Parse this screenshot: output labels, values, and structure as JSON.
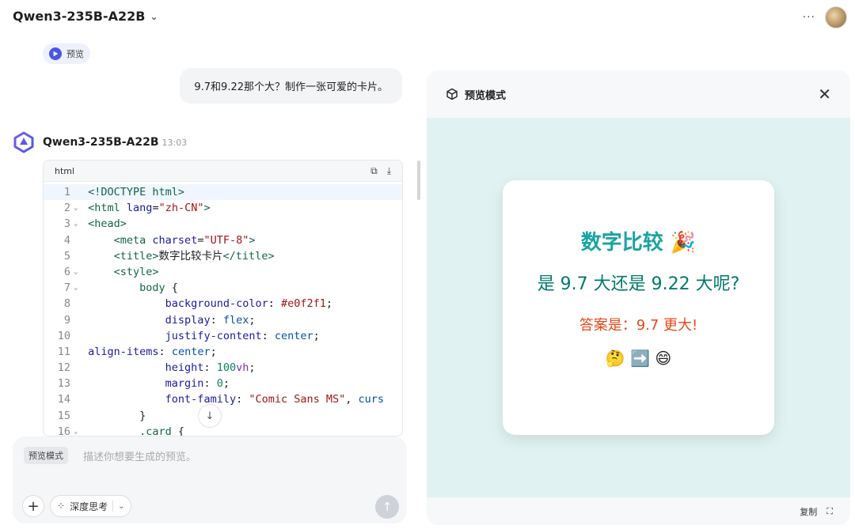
{
  "header": {
    "model_name": "Qwen3-235B-A22B",
    "more_label": "···"
  },
  "preview_pill": {
    "label": "预览"
  },
  "user_message": {
    "text": "9.7和9.22那个大？制作一张可爱的卡片。"
  },
  "assistant": {
    "name": "Qwen3-235B-A22B",
    "time": "13:03"
  },
  "code_block": {
    "lang": "html",
    "lines": [
      {
        "n": "1",
        "fold": "",
        "html": "<span class=\"tg\">&lt;!DOCTYPE html&gt;</span>"
      },
      {
        "n": "2",
        "fold": "⌄",
        "html": "<span class=\"tg\">&lt;html</span> <span class=\"at\">lang</span>=<span class=\"st\">\"zh-CN\"</span><span class=\"tg\">&gt;</span>"
      },
      {
        "n": "3",
        "fold": "⌄",
        "html": "<span class=\"tg\">&lt;head&gt;</span>"
      },
      {
        "n": "4",
        "fold": "",
        "html": "    <span class=\"tg\">&lt;meta</span> <span class=\"at\">charset</span>=<span class=\"st\">\"UTF-8\"</span><span class=\"tg\">&gt;</span>"
      },
      {
        "n": "5",
        "fold": "",
        "html": "    <span class=\"tg\">&lt;title&gt;</span>数字比较卡片<span class=\"tg\">&lt;/title&gt;</span>"
      },
      {
        "n": "6",
        "fold": "⌄",
        "html": "    <span class=\"tg\">&lt;style&gt;</span>"
      },
      {
        "n": "7",
        "fold": "⌄",
        "html": "        <span class=\"tg\">body</span> {"
      },
      {
        "n": "8",
        "fold": "",
        "html": "            <span class=\"at\">background-color</span>: <span class=\"st\">#e0f2f1</span>;"
      },
      {
        "n": "9",
        "fold": "",
        "html": "            <span class=\"at\">display</span>: <span class=\"kw\">flex</span>;"
      },
      {
        "n": "10",
        "fold": "",
        "html": "            <span class=\"at\">justify-content</span>: <span class=\"kw\">center</span>;"
      },
      {
        "n": "11",
        "fold": "",
        "html": "<span class=\"at\">align-items</span>: <span class=\"kw\">center</span>;"
      },
      {
        "n": "12",
        "fold": "",
        "html": "            <span class=\"at\">height</span>: <span class=\"nm\">100</span><span class=\"dt\">vh</span>;"
      },
      {
        "n": "13",
        "fold": "",
        "html": "            <span class=\"at\">margin</span>: <span class=\"nm\">0</span>;"
      },
      {
        "n": "14",
        "fold": "",
        "html": "            <span class=\"at\">font-family</span>: <span class=\"st\">\"Comic Sans MS\"</span>, <span class=\"kw\">curs</span>"
      },
      {
        "n": "15",
        "fold": "",
        "html": "        }"
      },
      {
        "n": "16",
        "fold": "⌄",
        "html": "        <span class=\"tg\">.card</span> {"
      }
    ]
  },
  "input": {
    "mode_tag": "预览模式",
    "placeholder": "描述你想要生成的预览。",
    "think_label": "深度思考"
  },
  "preview_panel": {
    "title": "预览模式",
    "copy_label": "复制",
    "card": {
      "title": "数字比较 🎉",
      "question": "是 9.7 大还是 9.22 大呢?",
      "answer": "答案是：9.7 更大!",
      "emoji": "🤔 ➡️ 😄"
    }
  },
  "colors": {
    "accent": "#4b56e6",
    "canvas_bg": "#e0f2f1",
    "card_title": "#1aa3a3",
    "card_question": "#00796b",
    "card_answer": "#e64a19"
  }
}
